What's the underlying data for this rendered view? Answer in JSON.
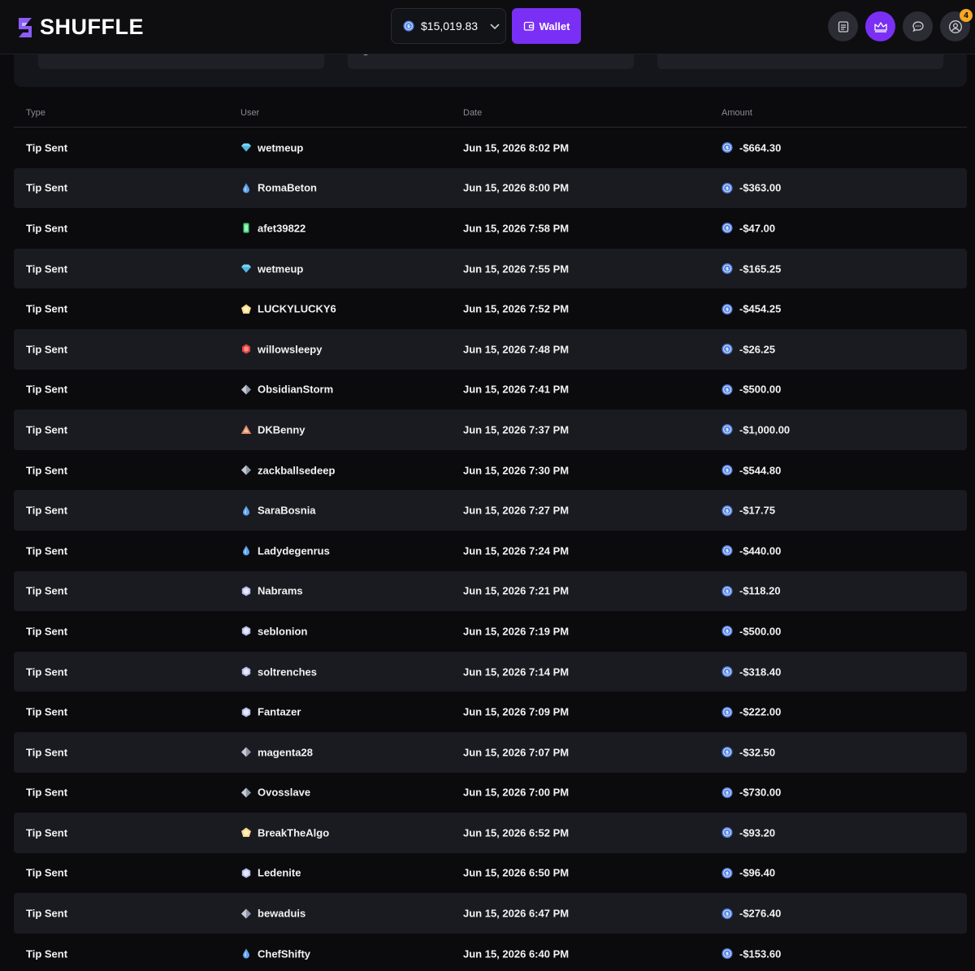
{
  "brand": {
    "name": "SHUFFLE"
  },
  "header": {
    "balance": "$15,019.83",
    "wallet_label": "Wallet",
    "notification_count": "4"
  },
  "table": {
    "columns": {
      "type": "Type",
      "user": "User",
      "date": "Date",
      "amount": "Amount"
    },
    "rows": [
      {
        "type": "Tip Sent",
        "user": "wetmeup",
        "rank": "diamond-icon",
        "date": "Jun 15, 2026 8:02 PM",
        "amount": "-$664.30"
      },
      {
        "type": "Tip Sent",
        "user": "RomaBeton",
        "rank": "droplet-icon",
        "date": "Jun 15, 2026 8:00 PM",
        "amount": "-$363.00"
      },
      {
        "type": "Tip Sent",
        "user": "afet39822",
        "rank": "emerald-icon",
        "date": "Jun 15, 2026 7:58 PM",
        "amount": "-$47.00"
      },
      {
        "type": "Tip Sent",
        "user": "wetmeup",
        "rank": "diamond-icon",
        "date": "Jun 15, 2026 7:55 PM",
        "amount": "-$165.25"
      },
      {
        "type": "Tip Sent",
        "user": "LUCKYLUCKY6",
        "rank": "pentagon-gold-icon",
        "date": "Jun 15, 2026 7:52 PM",
        "amount": "-$454.25"
      },
      {
        "type": "Tip Sent",
        "user": "willowsleepy",
        "rank": "ruby-icon",
        "date": "Jun 15, 2026 7:48 PM",
        "amount": "-$26.25"
      },
      {
        "type": "Tip Sent",
        "user": "ObsidianStorm",
        "rank": "steel-rhombus-icon",
        "date": "Jun 15, 2026 7:41 PM",
        "amount": "-$500.00"
      },
      {
        "type": "Tip Sent",
        "user": "DKBenny",
        "rank": "triangle-bronze-icon",
        "date": "Jun 15, 2026 7:37 PM",
        "amount": "-$1,000.00"
      },
      {
        "type": "Tip Sent",
        "user": "zackballsedeep",
        "rank": "steel-rhombus-icon",
        "date": "Jun 15, 2026 7:30 PM",
        "amount": "-$544.80"
      },
      {
        "type": "Tip Sent",
        "user": "SaraBosnia",
        "rank": "droplet-icon",
        "date": "Jun 15, 2026 7:27 PM",
        "amount": "-$17.75"
      },
      {
        "type": "Tip Sent",
        "user": "Ladydegenrus",
        "rank": "droplet-icon",
        "date": "Jun 15, 2026 7:24 PM",
        "amount": "-$440.00"
      },
      {
        "type": "Tip Sent",
        "user": "Nabrams",
        "rank": "hexagon-silver-icon",
        "date": "Jun 15, 2026 7:21 PM",
        "amount": "-$118.20"
      },
      {
        "type": "Tip Sent",
        "user": "seblonion",
        "rank": "hexagon-silver-icon",
        "date": "Jun 15, 2026 7:19 PM",
        "amount": "-$500.00"
      },
      {
        "type": "Tip Sent",
        "user": "soltrenches",
        "rank": "hexagon-silver-icon",
        "date": "Jun 15, 2026 7:14 PM",
        "amount": "-$318.40"
      },
      {
        "type": "Tip Sent",
        "user": "Fantazer",
        "rank": "hexagon-silver-icon",
        "date": "Jun 15, 2026 7:09 PM",
        "amount": "-$222.00"
      },
      {
        "type": "Tip Sent",
        "user": "magenta28",
        "rank": "steel-rhombus-icon",
        "date": "Jun 15, 2026 7:07 PM",
        "amount": "-$32.50"
      },
      {
        "type": "Tip Sent",
        "user": "Ovosslave",
        "rank": "steel-rhombus-icon",
        "date": "Jun 15, 2026 7:00 PM",
        "amount": "-$730.00"
      },
      {
        "type": "Tip Sent",
        "user": "BreakTheAlgo",
        "rank": "pentagon-gold-icon",
        "date": "Jun 15, 2026 6:52 PM",
        "amount": "-$93.20"
      },
      {
        "type": "Tip Sent",
        "user": "Ledenite",
        "rank": "hexagon-silver-icon",
        "date": "Jun 15, 2026 6:50 PM",
        "amount": "-$96.40"
      },
      {
        "type": "Tip Sent",
        "user": "bewaduis",
        "rank": "steel-rhombus-icon",
        "date": "Jun 15, 2026 6:47 PM",
        "amount": "-$276.40"
      },
      {
        "type": "Tip Sent",
        "user": "ChefShifty",
        "rank": "droplet-icon",
        "date": "Jun 15, 2026 6:40 PM",
        "amount": "-$153.60"
      }
    ]
  },
  "colors": {
    "accent": "#7a2ff5",
    "badge": "#f5a623",
    "coin": "#4f7fe0"
  }
}
